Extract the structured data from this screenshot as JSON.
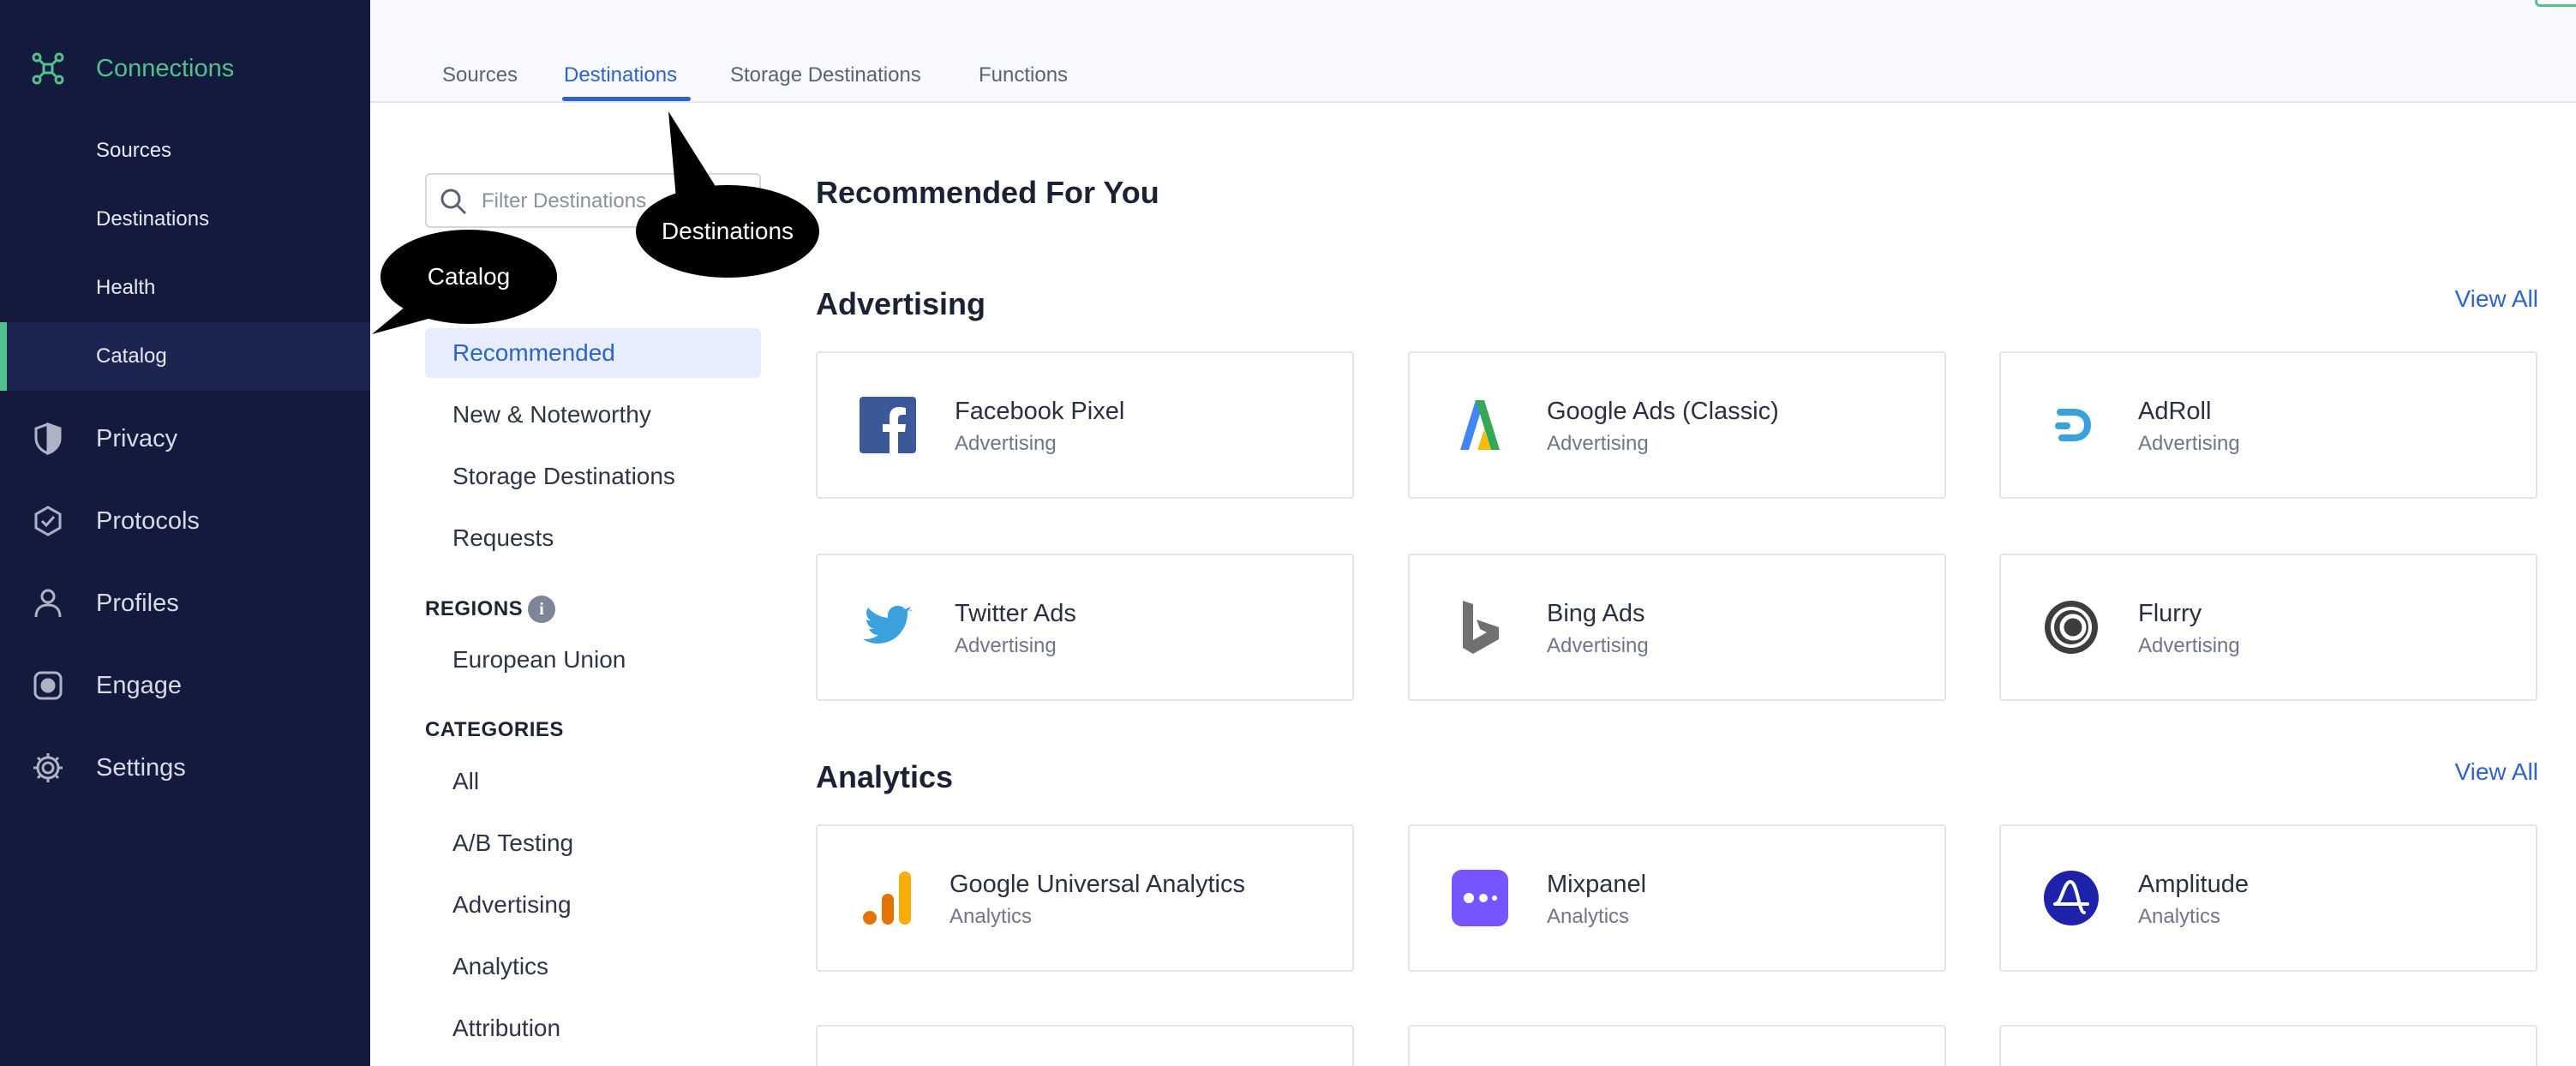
{
  "sidebar": {
    "connections": "Connections",
    "sub_items": [
      "Sources",
      "Destinations",
      "Health",
      "Catalog"
    ],
    "primary_items": [
      "Privacy",
      "Protocols",
      "Profiles",
      "Engage",
      "Settings"
    ]
  },
  "tabs": [
    "Sources",
    "Destinations",
    "Storage Destinations",
    "Functions"
  ],
  "active_tab": "Destinations",
  "filter": {
    "placeholder": "Filter Destinations"
  },
  "categories_nav": {
    "top_items": [
      "Recommended",
      "New & Noteworthy",
      "Storage Destinations",
      "Requests"
    ],
    "regions_heading": "REGIONS",
    "regions": [
      "European Union"
    ],
    "categories_heading": "CATEGORIES",
    "categories": [
      "All",
      "A/B Testing",
      "Advertising",
      "Analytics",
      "Attribution"
    ]
  },
  "main": {
    "heading": "Recommended For You",
    "view_all_label": "View All",
    "sections": [
      {
        "title": "Advertising",
        "cards": [
          {
            "name": "Facebook Pixel",
            "category": "Advertising",
            "icon": "facebook-icon"
          },
          {
            "name": "Google Ads (Classic)",
            "category": "Advertising",
            "icon": "google-ads-icon"
          },
          {
            "name": "AdRoll",
            "category": "Advertising",
            "icon": "adroll-icon"
          },
          {
            "name": "Twitter Ads",
            "category": "Advertising",
            "icon": "twitter-icon"
          },
          {
            "name": "Bing Ads",
            "category": "Advertising",
            "icon": "bing-icon"
          },
          {
            "name": "Flurry",
            "category": "Advertising",
            "icon": "flurry-icon"
          }
        ]
      },
      {
        "title": "Analytics",
        "cards": [
          {
            "name": "Google Universal Analytics",
            "category": "Analytics",
            "icon": "google-analytics-icon"
          },
          {
            "name": "Mixpanel",
            "category": "Analytics",
            "icon": "mixpanel-icon"
          },
          {
            "name": "Amplitude",
            "category": "Analytics",
            "icon": "amplitude-icon"
          }
        ]
      }
    ]
  },
  "callouts": {
    "catalog": "Catalog",
    "destinations": "Destinations"
  },
  "colors": {
    "sidebar_bg": "#131a3d",
    "accent_green": "#52c08f",
    "link_blue": "#2e63c9"
  }
}
